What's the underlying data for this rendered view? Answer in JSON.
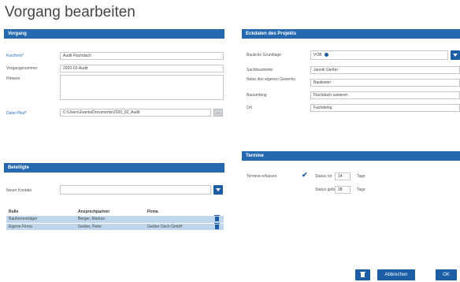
{
  "page_title": "Vorgang bearbeiten",
  "colors": {
    "header": "#2468b0",
    "accent": "#1b5ea6",
    "row": "#bfd6ec"
  },
  "vorgang": {
    "header": "Vorgang",
    "kurzform_label": "Kurzform*",
    "kurzform_value": "Audit Flachdach",
    "vorgangsnummer_label": "Vorgangsnummer",
    "vorgangsnummer_value": "2020-02-Audit",
    "hinweis_label": "Hinweis",
    "hinweis_value": "",
    "datei_pfad_label": "Datei-Pfad*",
    "datei_pfad_value": "C:\\Users\\Joanta\\Documents\\2020_02_Audit",
    "path_button": "..."
  },
  "eckdaten": {
    "header": "Eckdaten des Projekts",
    "bauliche_label": "Bauliche Grundlage",
    "bauliche_value": "VOB",
    "bauliche_icon": "info-icon",
    "sachbearbeiter_label": "Sachbearbeiter",
    "sachbearbeiter_value": "Jannik Gießer",
    "nature_label": "Natur des eigenen Gewerks",
    "nature_value": "Bauleister",
    "bauumfang_label": "Bauumfang",
    "bauumfang_value": "Flachdach sanieren",
    "ort_label": "Ort",
    "ort_value": "Fachdeing"
  },
  "termine": {
    "header": "Termine",
    "termine_label": "Termine erfassen",
    "status_rot_label": "Status rot",
    "status_rot_value": "14",
    "status_gelb_label": "Status gelb",
    "status_gelb_value": "28",
    "tage1": "Tage",
    "tage2": "Tage"
  },
  "beteiligte": {
    "header": "Beteiligte",
    "neuer_kontakt_label": "Neuer Kontakt",
    "neuer_kontakt_value": "",
    "columns": [
      "Rolle",
      "Ansprechpartner",
      "Firma"
    ],
    "rows": [
      {
        "rolle": "Bauherrenträger",
        "ansprechpartner": "Berger, Markus",
        "firma": ""
      },
      {
        "rolle": "Eigene Firma",
        "ansprechpartner": "Gerber, Peter",
        "firma": "Gerber Dach GmbH"
      }
    ]
  },
  "footer": {
    "abbrechen": "Abbrechen",
    "ok": "OK"
  }
}
